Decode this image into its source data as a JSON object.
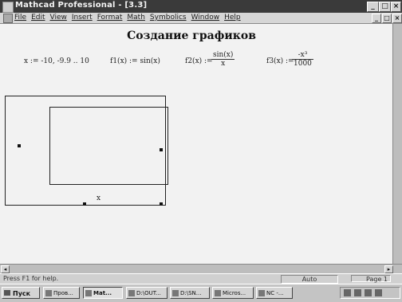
{
  "window": {
    "title": "Mathcad Professional - [3.3]",
    "btn_min": "_",
    "btn_max": "□",
    "btn_close": "×"
  },
  "menu": [
    "File",
    "Edit",
    "View",
    "Insert",
    "Format",
    "Math",
    "Symbolics",
    "Window",
    "Help"
  ],
  "doc_controls": {
    "min": "_",
    "restore": "□",
    "close": "×"
  },
  "worksheet": {
    "heading": "Создание графиков",
    "range": "x := -10, -9.9 .. 10",
    "f1": "f1(x) := sin(x)",
    "f2_lhs": "f2(x) :=",
    "f2_num": "sin(x)",
    "f2_den": "x",
    "f3_lhs": "f3(x) :=",
    "f3_num": "-x³",
    "f3_den": "1000",
    "plot_x_placeholder": "x"
  },
  "status": {
    "help": "Press F1 for help.",
    "mode": "Auto",
    "page": "Page 1"
  },
  "taskbar": {
    "start": "Пуск",
    "tasks": [
      "Пров...",
      "Mat...",
      "D:\\OUT...",
      "D:\\SN...",
      "Micros...",
      "NC -..."
    ]
  },
  "colors": {
    "titlebar": "#3a3a3a",
    "worksheet_bg": "#f2f2f2"
  }
}
